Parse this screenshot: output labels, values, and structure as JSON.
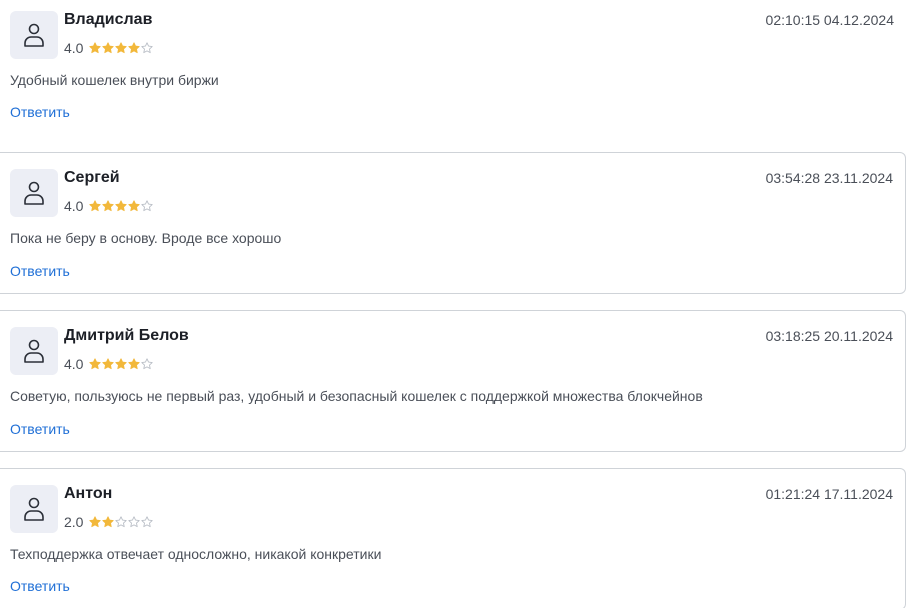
{
  "reviews": [
    {
      "author": "Владислав",
      "rating": "4.0",
      "stars": 4,
      "date": "02:10:15 04.12.2024",
      "text": "Удобный кошелек внутри биржи",
      "reply_label": "Ответить"
    },
    {
      "author": "Сергей",
      "rating": "4.0",
      "stars": 4,
      "date": "03:54:28 23.11.2024",
      "text": "Пока не беру в основу. Вроде все хорошо",
      "reply_label": "Ответить"
    },
    {
      "author": "Дмитрий Белов",
      "rating": "4.0",
      "stars": 4,
      "date": "03:18:25 20.11.2024",
      "text": "Советую, пользуюсь не первый раз, удобный и безопасный кошелек с поддержкой множества блокчейнов",
      "reply_label": "Ответить"
    },
    {
      "author": "Антон",
      "rating": "2.0",
      "stars": 2,
      "date": "01:21:24 17.11.2024",
      "text": "Техподдержка отвечает односложно, никакой конкретики",
      "reply_label": "Ответить"
    }
  ],
  "max_stars": 5,
  "colors": {
    "star_filled": "#f2b83b",
    "star_empty": "#b9bec6",
    "link": "#1f6fd6",
    "avatar_bg": "#eceef5"
  },
  "icons": {
    "avatar": "user-icon",
    "star": "star-icon"
  }
}
